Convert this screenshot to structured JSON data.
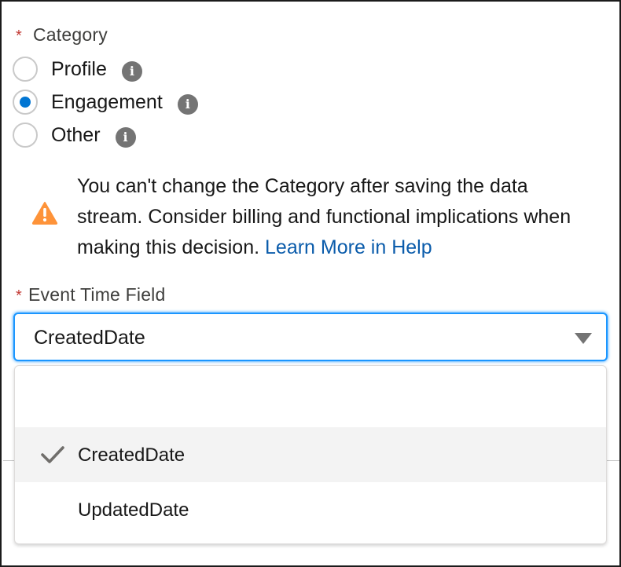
{
  "category": {
    "required_marker": "*",
    "label": "Category",
    "options": [
      {
        "label": "Profile",
        "selected": false,
        "info_icon": "info-icon"
      },
      {
        "label": "Engagement",
        "selected": true,
        "info_icon": "info-icon"
      },
      {
        "label": "Other",
        "selected": false,
        "info_icon": "info-icon"
      }
    ]
  },
  "warning": {
    "icon": "warning-icon",
    "text": "You can't change the Category after saving the data stream. Consider billing and functional implications when making this decision.",
    "link_text": "Learn More in Help"
  },
  "event_time_field": {
    "required_marker": "*",
    "label": "Event Time Field",
    "value": "CreatedDate",
    "options": [
      {
        "label": "",
        "selected": false
      },
      {
        "label": "CreatedDate",
        "selected": true
      },
      {
        "label": "UpdatedDate",
        "selected": false
      }
    ]
  },
  "colors": {
    "accent": "#0176d3",
    "focus_border": "#1b96ff",
    "required": "#c23934",
    "warning": "#fe9339",
    "link": "#0b5cab"
  }
}
